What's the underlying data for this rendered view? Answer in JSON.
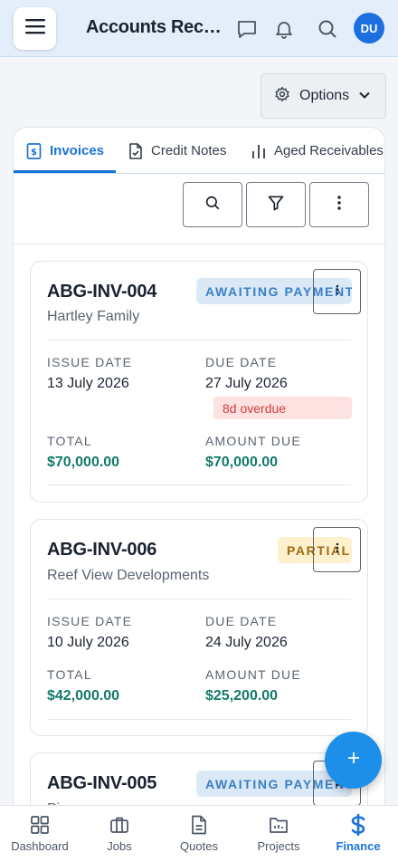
{
  "header": {
    "title": "Accounts Receivable",
    "avatar_initials": "DU"
  },
  "options": {
    "label": "Options"
  },
  "tabs": [
    {
      "label": "Invoices",
      "icon": "invoice-icon",
      "active": true
    },
    {
      "label": "Credit Notes",
      "icon": "credit-note-icon",
      "active": false
    },
    {
      "label": "Aged Receivables",
      "icon": "bar-chart-icon",
      "active": false
    }
  ],
  "labels": {
    "issue_date": "ISSUE DATE",
    "due_date": "DUE DATE",
    "total": "TOTAL",
    "amount_due": "AMOUNT DUE"
  },
  "invoices": [
    {
      "number": "ABG-INV-004",
      "client": "Hartley Family",
      "status": "AWAITING PAYMENT",
      "issue_date": "13 July 2026",
      "due_date": "27 July 2026",
      "overdue": "8d overdue",
      "total": "$70,000.00",
      "amount_due": "$70,000.00"
    },
    {
      "number": "ABG-INV-006",
      "client": "Reef View Developments",
      "status": "PARTIAL",
      "issue_date": "10 July 2026",
      "due_date": "24 July 2026",
      "total": "$42,000.00",
      "amount_due": "$25,200.00"
    },
    {
      "number": "ABG-INV-005",
      "client": "Pioneer",
      "status": "AWAITING PAYMENT"
    }
  ],
  "bottom_nav": [
    {
      "label": "Dashboard",
      "icon": "dashboard-icon",
      "active": false
    },
    {
      "label": "Jobs",
      "icon": "briefcase-icon",
      "active": false
    },
    {
      "label": "Quotes",
      "icon": "document-icon",
      "active": false
    },
    {
      "label": "Projects",
      "icon": "folder-icon",
      "active": false
    },
    {
      "label": "Finance",
      "icon": "dollar-icon",
      "active": true
    }
  ],
  "colors": {
    "accent": "#1a73d6",
    "money": "#147a6a",
    "awaiting_badge": "#dbe9f7",
    "partial_badge": "#fdf0cc",
    "overdue_badge": "#fde2e2"
  }
}
